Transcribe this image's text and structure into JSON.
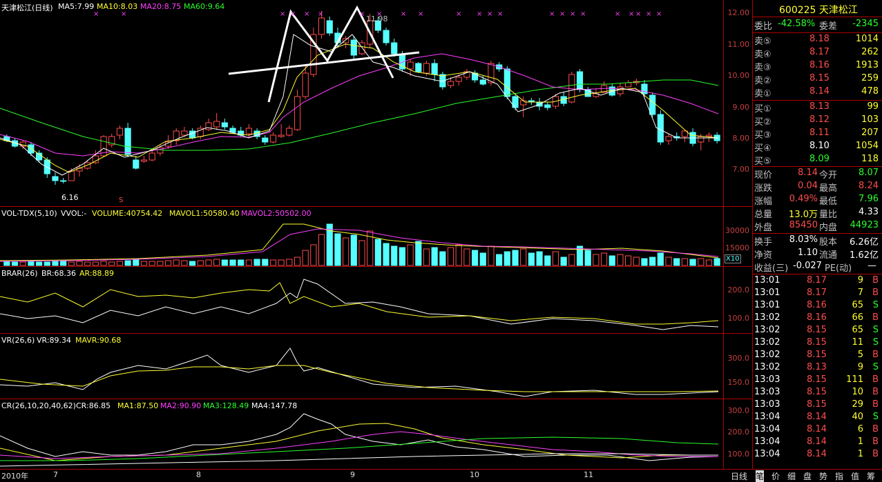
{
  "main_panel": {
    "title": "天津松江(日线)",
    "ma": [
      "MA5:7.99",
      "MA10:8.03",
      "MA20:8.75",
      "MA60:9.64"
    ],
    "y_ticks": [
      "12.00",
      "11.00",
      "10.00",
      "9.00",
      "8.00",
      "7.00"
    ],
    "peak_label": "11.98",
    "low_label": "6.16",
    "event_marker": "S"
  },
  "vol_panel": {
    "title": "VOL-TDX(5,10)",
    "vvol": "VVOL:-",
    "volume": "VOLUME:40754.42",
    "mavol1": "MAVOL1:50580.40",
    "mavol2": "MAVOL2:50502.00",
    "y_ticks": [
      "30000",
      "15000"
    ],
    "unit": "X10"
  },
  "brar_panel": {
    "title": "BRAR(26)",
    "br": "BR:68.36",
    "ar": "AR:88.89",
    "y_ticks": [
      "200.0",
      "100.0"
    ]
  },
  "vr_panel": {
    "title": "VR(26,6)",
    "vr": "VR:89.34",
    "mavr": "MAVR:90.68",
    "y_ticks": [
      "300.0",
      "150.0"
    ]
  },
  "cr_panel": {
    "title": "CR(26,10,20,40,62)",
    "cr": "CR:86.85",
    "ma1": "MA1:87.50",
    "ma2": "MA2:90.90",
    "ma3": "MA3:128.49",
    "ma4": "MA4:147.78",
    "y_ticks": [
      "300.0",
      "200.0",
      "100.0"
    ]
  },
  "x_axis": [
    "2010年",
    "7",
    "8",
    "9",
    "10",
    "11"
  ],
  "period_label": "日线",
  "quote": {
    "code_name": "600225 天津松江",
    "weibi_label": "委比",
    "weibi": "-42.58%",
    "weicha_label": "委差",
    "weicha": "-2345",
    "asks": [
      {
        "label": "卖⑤",
        "price": "8.18",
        "vol": "1014"
      },
      {
        "label": "卖④",
        "price": "8.17",
        "vol": "262"
      },
      {
        "label": "卖③",
        "price": "8.16",
        "vol": "1913"
      },
      {
        "label": "卖②",
        "price": "8.15",
        "vol": "259"
      },
      {
        "label": "卖①",
        "price": "8.14",
        "vol": "478"
      }
    ],
    "bids": [
      {
        "label": "买①",
        "price": "8.13",
        "vol": "99"
      },
      {
        "label": "买②",
        "price": "8.12",
        "vol": "103"
      },
      {
        "label": "买③",
        "price": "8.11",
        "vol": "207"
      },
      {
        "label": "买④",
        "price": "8.10",
        "vol": "1054"
      },
      {
        "label": "买⑤",
        "price": "8.09",
        "vol": "118"
      }
    ],
    "stats": [
      {
        "l1": "现价",
        "v1": "8.14",
        "l2": "今开",
        "v2": "8.07"
      },
      {
        "l1": "涨跌",
        "v1": "0.04",
        "l2": "最高",
        "v2": "8.24"
      },
      {
        "l1": "涨幅",
        "v1": "0.49%",
        "l2": "最低",
        "v2": "7.96"
      },
      {
        "l1": "总量",
        "v1": "13.0万",
        "l2": "量比",
        "v2": "4.33"
      },
      {
        "l1": "外盘",
        "v1": "85450",
        "l2": "内盘",
        "v2": "44923"
      }
    ],
    "stats2": [
      {
        "l1": "换手",
        "v1": "8.03%",
        "l2": "股本",
        "v2": "6.26亿"
      },
      {
        "l1": "净资",
        "v1": "1.10",
        "l2": "流通",
        "v2": "1.62亿"
      }
    ],
    "eps_label": "收益(三)",
    "eps": "-0.027",
    "pe_label": "PE(动)",
    "pe": "—",
    "ticks": [
      {
        "t": "13:01",
        "p": "8.17",
        "v": "9",
        "d": "B"
      },
      {
        "t": "13:01",
        "p": "8.17",
        "v": "7",
        "d": "B"
      },
      {
        "t": "13:01",
        "p": "8.16",
        "v": "65",
        "d": "S"
      },
      {
        "t": "13:02",
        "p": "8.16",
        "v": "66",
        "d": "B"
      },
      {
        "t": "13:02",
        "p": "8.15",
        "v": "65",
        "d": "S"
      },
      {
        "t": "13:02",
        "p": "8.15",
        "v": "11",
        "d": "S"
      },
      {
        "t": "13:02",
        "p": "8.15",
        "v": "5",
        "d": "B"
      },
      {
        "t": "13:02",
        "p": "8.13",
        "v": "9",
        "d": "S"
      },
      {
        "t": "13:03",
        "p": "8.15",
        "v": "111",
        "d": "B"
      },
      {
        "t": "13:03",
        "p": "8.15",
        "v": "10",
        "d": "B"
      },
      {
        "t": "13:03",
        "p": "8.15",
        "v": "29",
        "d": "B"
      },
      {
        "t": "13:04",
        "p": "8.14",
        "v": "40",
        "d": "S"
      },
      {
        "t": "13:04",
        "p": "8.14",
        "v": "6",
        "d": "B"
      },
      {
        "t": "13:04",
        "p": "8.14",
        "v": "1",
        "d": "B"
      },
      {
        "t": "13:04",
        "p": "8.14",
        "v": "1",
        "d": "B"
      }
    ]
  },
  "tabs": [
    "笔",
    "价",
    "细",
    "盘",
    "势",
    "指",
    "值",
    "筹"
  ],
  "colors": {
    "up": "#ff4d4d",
    "down": "#55ffff",
    "ma5": "#ffffff",
    "ma10": "#ffff33",
    "ma20": "#ff40ff",
    "ma60": "#2aff2a",
    "grid": "#b00000"
  }
}
